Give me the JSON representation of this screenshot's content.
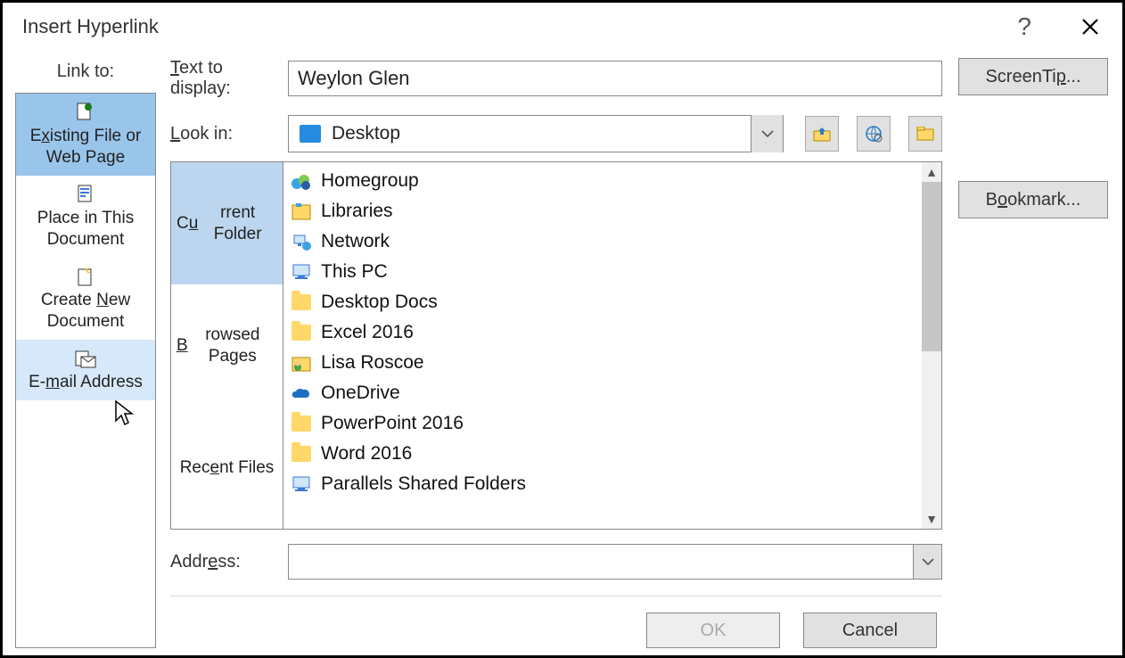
{
  "title": "Insert Hyperlink",
  "link_to_label": "Link to:",
  "linkto": {
    "existing": "Existing File or Web Page",
    "place": "Place in This Document",
    "createnew": "Create New Document",
    "email": "E-mail Address"
  },
  "text_to_display_label": "Text to display:",
  "text_to_display_value": "Weylon Glen",
  "look_in_label": "Look in:",
  "look_in_value": "Desktop",
  "tabs": {
    "current": "Current Folder",
    "browsed": "Browsed Pages",
    "recent": "Recent Files"
  },
  "files": [
    {
      "name": "Homegroup",
      "icon": "homegroup"
    },
    {
      "name": "Libraries",
      "icon": "libraries"
    },
    {
      "name": "Network",
      "icon": "network"
    },
    {
      "name": "This PC",
      "icon": "thispc"
    },
    {
      "name": "Desktop Docs",
      "icon": "folder"
    },
    {
      "name": "Excel 2016",
      "icon": "folder"
    },
    {
      "name": "Lisa Roscoe",
      "icon": "userfolder"
    },
    {
      "name": "OneDrive",
      "icon": "onedrive"
    },
    {
      "name": "PowerPoint 2016",
      "icon": "folder"
    },
    {
      "name": "Word 2016",
      "icon": "folder"
    },
    {
      "name": "Parallels Shared Folders",
      "icon": "thispc"
    }
  ],
  "address_label": "Address:",
  "address_value": "",
  "buttons": {
    "screentip": "ScreenTip...",
    "bookmark": "Bookmark...",
    "ok": "OK",
    "cancel": "Cancel"
  },
  "underline": {
    "existing": "x",
    "lookin": "L",
    "browsed": "B",
    "recent": "e",
    "new": "N",
    "mail": "m",
    "address": "e",
    "bookmark": "o",
    "screentip": "p",
    "text": "T"
  }
}
